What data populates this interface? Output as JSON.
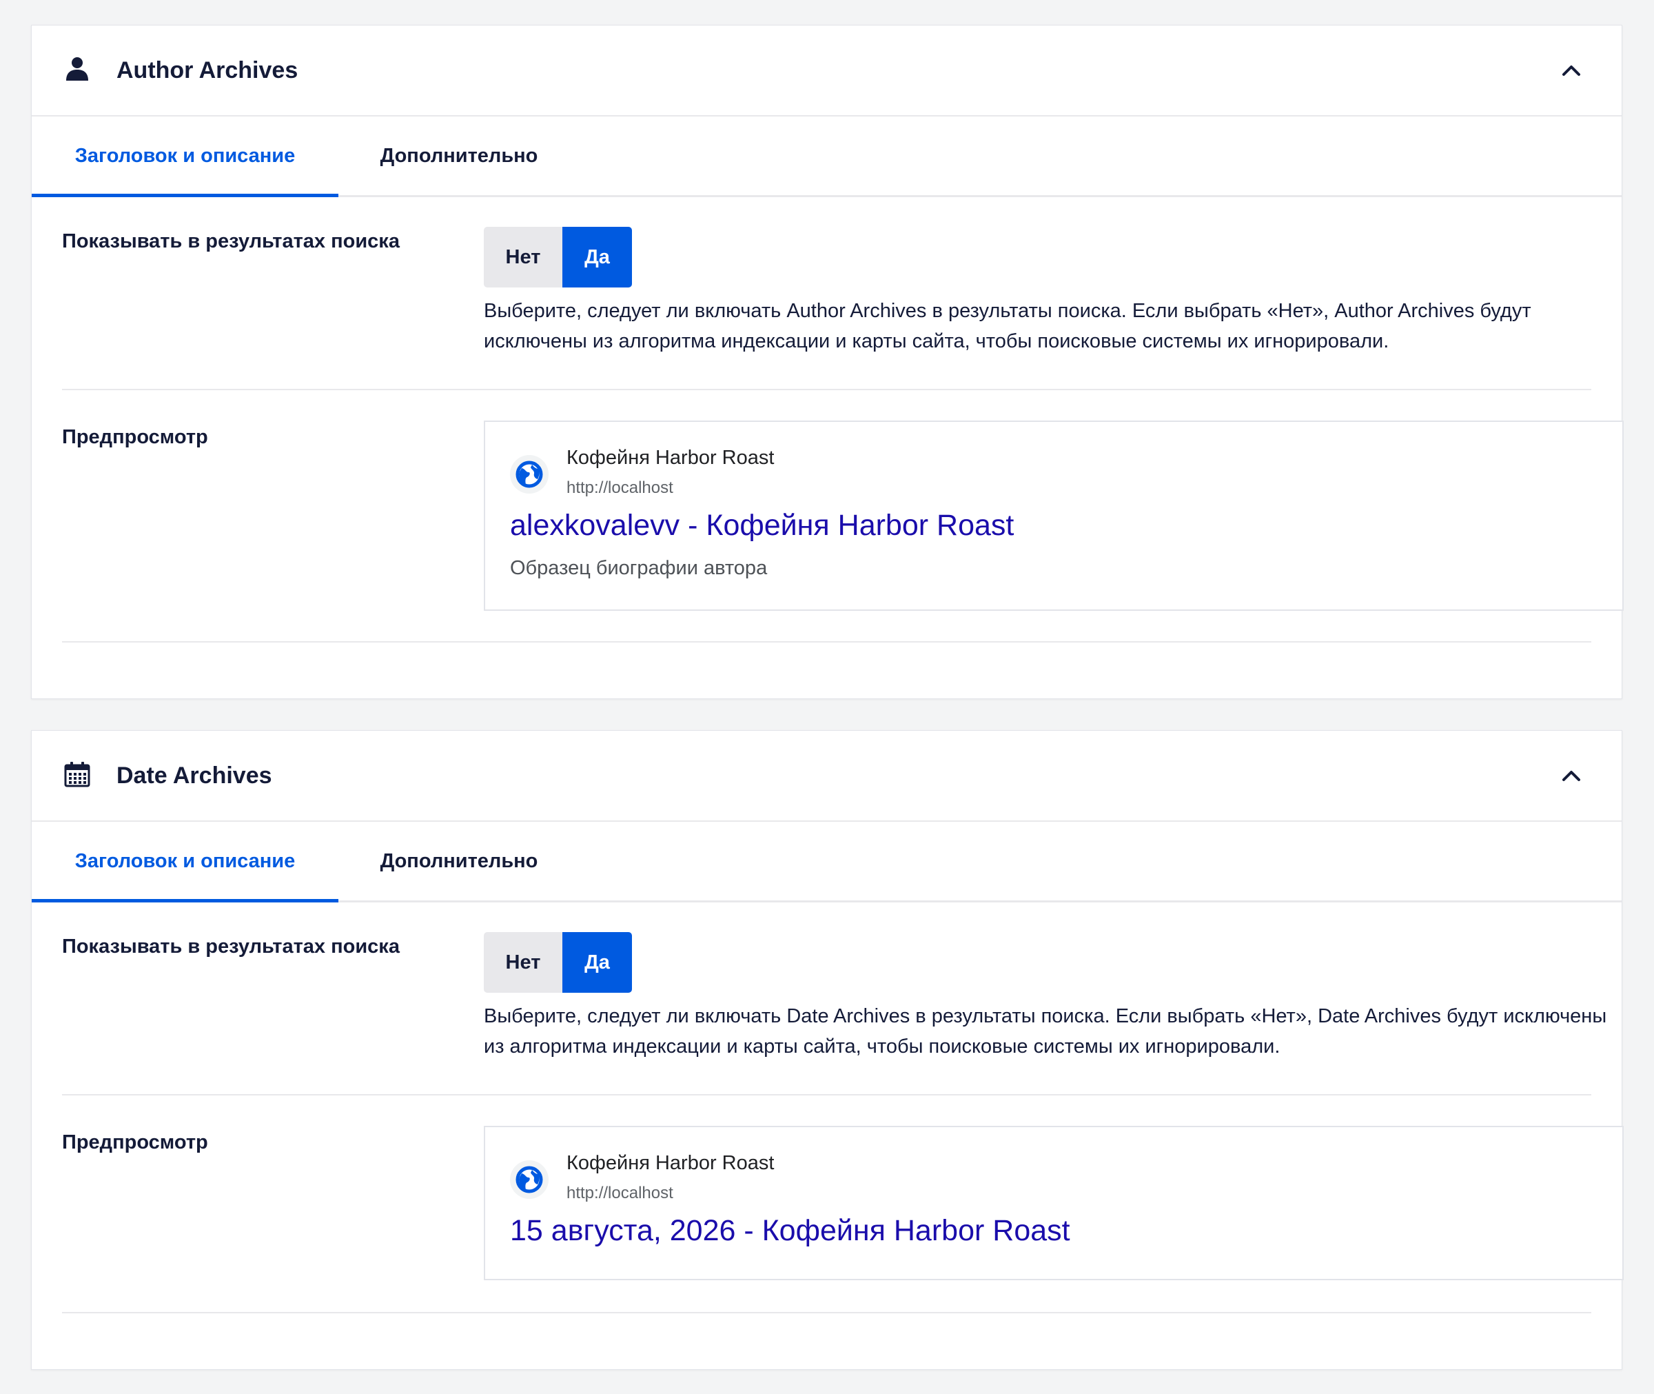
{
  "sections": [
    {
      "title": "Author Archives",
      "icon": "user-icon",
      "tabs": [
        "Заголовок и описание",
        "Дополнительно"
      ],
      "active_tab": 0,
      "visibility": {
        "label": "Показывать в результатах поиска",
        "options": [
          "Нет",
          "Да"
        ],
        "selected": "Да",
        "description": "Выберите, следует ли включать Author Archives в результаты поиска. Если выбрать «Нет», Author Archives будут исключены из алгоритма индексации и карты сайта, чтобы поисковые системы их игнорировали."
      },
      "preview": {
        "label": "Предпросмотр",
        "site_name": "Кофейня Harbor Roast",
        "url": "http://localhost",
        "title": "alexkovalevv - Кофейня Harbor Roast",
        "description": "Образец биографии автора"
      }
    },
    {
      "title": "Date Archives",
      "icon": "calendar-icon",
      "tabs": [
        "Заголовок и описание",
        "Дополнительно"
      ],
      "active_tab": 0,
      "visibility": {
        "label": "Показывать в результатах поиска",
        "options": [
          "Нет",
          "Да"
        ],
        "selected": "Да",
        "description": "Выберите, следует ли включать Date Archives в результаты поиска. Если выбрать «Нет», Date Archives будут исключены из алгоритма индексации и карты сайта, чтобы поисковые системы их игнорировали."
      },
      "preview": {
        "label": "Предпросмотр",
        "site_name": "Кофейня Harbor Roast",
        "url": "http://localhost",
        "title": "15 августа, 2026 - Кофейня Harbor Roast",
        "description": ""
      }
    }
  ],
  "colors": {
    "accent": "#005ae0",
    "serp_title": "#1a0dab",
    "text": "#141b38",
    "background": "#f3f4f5"
  }
}
